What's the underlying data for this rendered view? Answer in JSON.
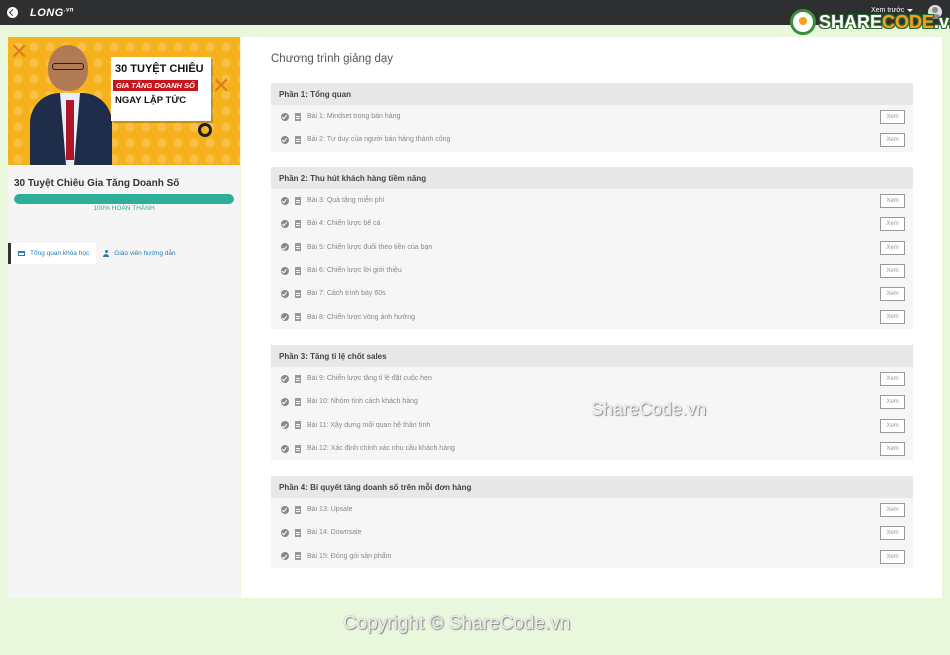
{
  "topbar": {
    "logo": "LONG",
    "logo_suffix": ".vn",
    "preview_label": "Xem trước"
  },
  "brand": {
    "name_part1": "SHARE",
    "name_part2": "CODE",
    "name_part3": ".vn"
  },
  "banner": {
    "line1": "30 TUYỆT CHIÊU",
    "line2": "GIA TĂNG DOANH SỐ",
    "line3": "NGAY LẬP TỨC"
  },
  "course": {
    "title": "30 Tuyệt Chiêu Gia Tăng Doanh Số",
    "progress_percent": 100,
    "progress_value": "100%",
    "progress_text": "HOÀN THÀNH"
  },
  "tabs": [
    {
      "label": "Tổng quan khóa học",
      "active": true
    },
    {
      "label": "Giáo viên hướng dẫn",
      "active": false
    }
  ],
  "curriculum": {
    "heading": "Chương trình giảng dạy",
    "view_label": "Xem",
    "sections": [
      {
        "title": "Phần 1: Tổng quan",
        "lessons": [
          "Bài 1: Mindset trong bán hàng",
          "Bài 2: Tư duy của người bán hàng thành công"
        ]
      },
      {
        "title": "Phần 2: Thu hút khách hàng tiềm năng",
        "lessons": [
          "Bài 3: Quà tặng miễn phí",
          "Bài 4: Chiến lược bể cá",
          "Bài 5: Chiến lược đuổi theo tiền của bạn",
          "Bài 6: Chiến lược lời giới thiệu",
          "Bài 7: Cách trình bày 60s",
          "Bài 8: Chiến lược vòng ảnh hưởng"
        ]
      },
      {
        "title": "Phần 3: Tăng tỉ lệ chốt sales",
        "lessons": [
          "Bài 9: Chiến lược tăng tỉ lệ đặt cuộc hẹn",
          "Bài 10: Nhóm tính cách khách hàng",
          "Bài 11: Xây dựng mối quan hệ thân tình",
          "Bài 12: Xác định chính xác nhu cầu khách hàng"
        ]
      },
      {
        "title": "Phần 4: Bí quyết tăng doanh số trên mỗi đơn hàng",
        "lessons": [
          "Bài 13: Upsale",
          "Bài 14: Downsale",
          "Bài 15: Đóng gói sản phẩm"
        ]
      }
    ]
  },
  "watermark": "ShareCode.vn",
  "copyright": "Copyright © ShareCode.vn"
}
